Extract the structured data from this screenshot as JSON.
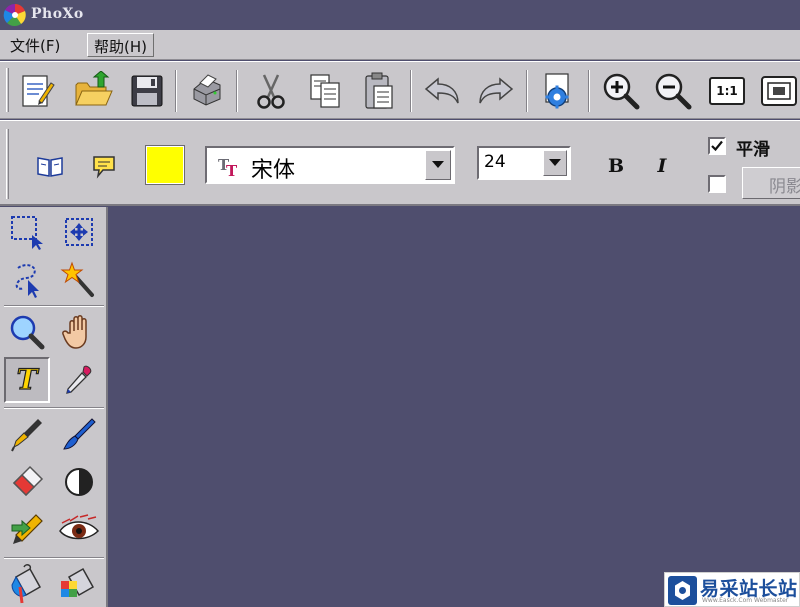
{
  "window": {
    "title": "PhoXo"
  },
  "menu": {
    "items": [
      {
        "label": "文件(F)"
      },
      {
        "label": "帮助(H)"
      }
    ]
  },
  "toolbar": {
    "buttons": [
      {
        "name": "new-document",
        "icon": "notepad-pencil-icon"
      },
      {
        "name": "open",
        "icon": "folder-open-icon"
      },
      {
        "name": "save",
        "icon": "floppy-disk-icon"
      },
      {
        "name": "print",
        "icon": "printer-icon"
      },
      {
        "name": "cut",
        "icon": "scissors-icon"
      },
      {
        "name": "copy",
        "icon": "copy-icon"
      },
      {
        "name": "paste",
        "icon": "clipboard-icon"
      },
      {
        "name": "undo",
        "icon": "undo-arrow-icon"
      },
      {
        "name": "redo",
        "icon": "redo-arrow-icon"
      },
      {
        "name": "settings",
        "icon": "gear-document-icon"
      },
      {
        "name": "zoom-in",
        "icon": "zoom-in-icon"
      },
      {
        "name": "zoom-out",
        "icon": "zoom-out-icon"
      },
      {
        "name": "actual-size",
        "icon": "actual-size-icon",
        "label": "1:1"
      },
      {
        "name": "fit-window",
        "icon": "fit-window-icon"
      }
    ]
  },
  "text_options": {
    "font_name": "宋体",
    "font_size": "24",
    "text_color": "#ffff00",
    "bold_label": "B",
    "italic_label": "I",
    "smooth_label": "平滑",
    "smooth_checked": true,
    "shadow_checked": false,
    "shadow_button_label": "阴影"
  },
  "tools": [
    {
      "name": "rect-select",
      "icon": "rect-select-icon"
    },
    {
      "name": "move-select",
      "icon": "move-selection-icon"
    },
    {
      "name": "lasso-select",
      "icon": "lasso-icon"
    },
    {
      "name": "magic-wand",
      "icon": "magic-wand-icon"
    },
    {
      "name": "zoom",
      "icon": "magnifier-icon"
    },
    {
      "name": "hand",
      "icon": "hand-icon"
    },
    {
      "name": "text",
      "icon": "text-tool-icon",
      "label": "T",
      "active": true
    },
    {
      "name": "eyedropper",
      "icon": "eyedropper-icon"
    },
    {
      "name": "pen",
      "icon": "fountain-pen-icon"
    },
    {
      "name": "brush",
      "icon": "brush-icon"
    },
    {
      "name": "eraser",
      "icon": "eraser-icon"
    },
    {
      "name": "contrast",
      "icon": "contrast-icon"
    },
    {
      "name": "clone",
      "icon": "clone-pencil-icon"
    },
    {
      "name": "red-eye",
      "icon": "eye-icon"
    },
    {
      "name": "paint-bucket",
      "icon": "paint-bucket-icon"
    },
    {
      "name": "gradient-fill",
      "icon": "gradient-bucket-icon"
    }
  ],
  "watermark": {
    "text": "易采站长站",
    "sub": "Www.Easck.Com Webmaster"
  },
  "colors": {
    "background": "#4f4e6e",
    "chrome": "#c9c7cb"
  }
}
